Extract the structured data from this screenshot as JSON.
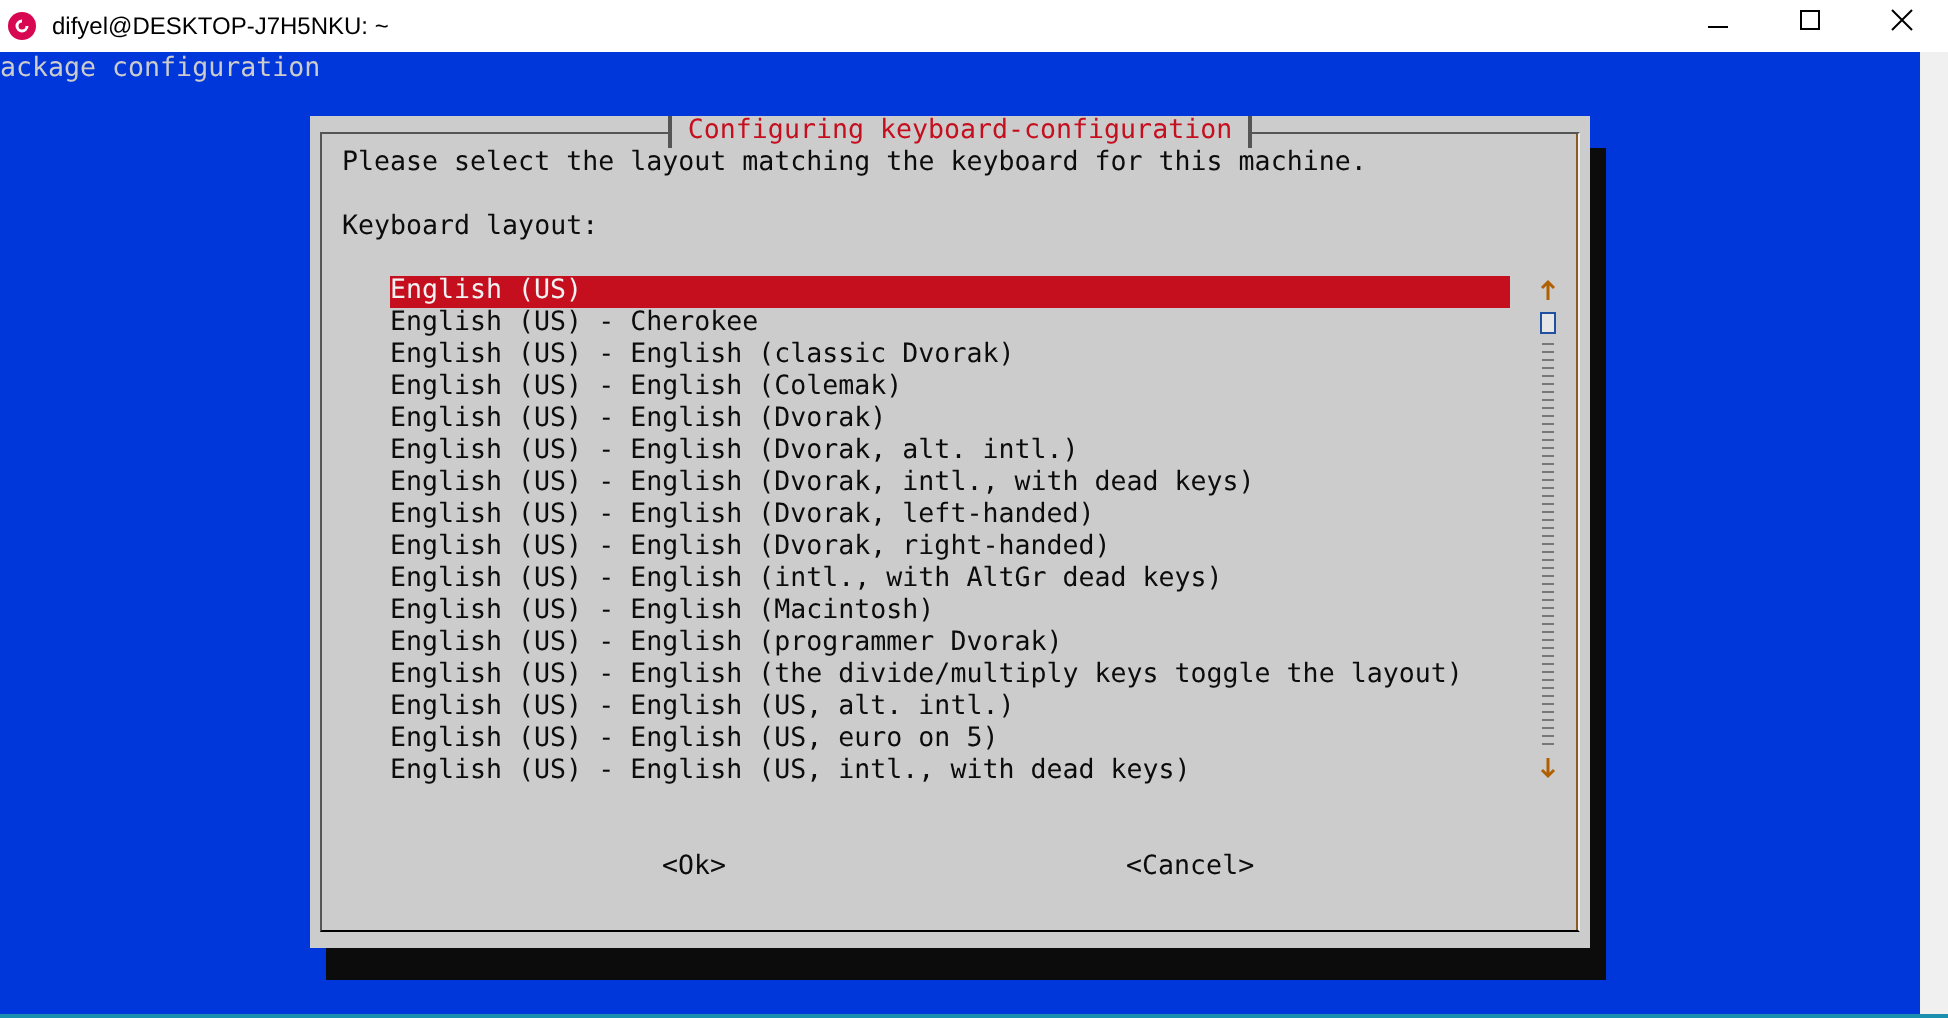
{
  "window": {
    "title": "difyel@DESKTOP-J7H5NKU: ~"
  },
  "backtitle": "ackage configuration",
  "dialog": {
    "title": "Configuring keyboard-configuration",
    "prompt": "Please select the layout matching the keyboard for this machine.",
    "list_label": "Keyboard layout:",
    "items": [
      {
        "label": "English (US)",
        "selected": true
      },
      {
        "label": "English (US) - Cherokee",
        "selected": false
      },
      {
        "label": "English (US) - English (classic Dvorak)",
        "selected": false
      },
      {
        "label": "English (US) - English (Colemak)",
        "selected": false
      },
      {
        "label": "English (US) - English (Dvorak)",
        "selected": false
      },
      {
        "label": "English (US) - English (Dvorak, alt. intl.)",
        "selected": false
      },
      {
        "label": "English (US) - English (Dvorak, intl., with dead keys)",
        "selected": false
      },
      {
        "label": "English (US) - English (Dvorak, left-handed)",
        "selected": false
      },
      {
        "label": "English (US) - English (Dvorak, right-handed)",
        "selected": false
      },
      {
        "label": "English (US) - English (intl., with AltGr dead keys)",
        "selected": false
      },
      {
        "label": "English (US) - English (Macintosh)",
        "selected": false
      },
      {
        "label": "English (US) - English (programmer Dvorak)",
        "selected": false
      },
      {
        "label": "English (US) - English (the divide/multiply keys toggle the layout)",
        "selected": false
      },
      {
        "label": "English (US) - English (US, alt. intl.)",
        "selected": false
      },
      {
        "label": "English (US) - English (US, euro on 5)",
        "selected": false
      },
      {
        "label": "English (US) - English (US, intl., with dead keys)",
        "selected": false
      }
    ],
    "buttons": [
      "<Ok>",
      "<Cancel>"
    ]
  }
}
